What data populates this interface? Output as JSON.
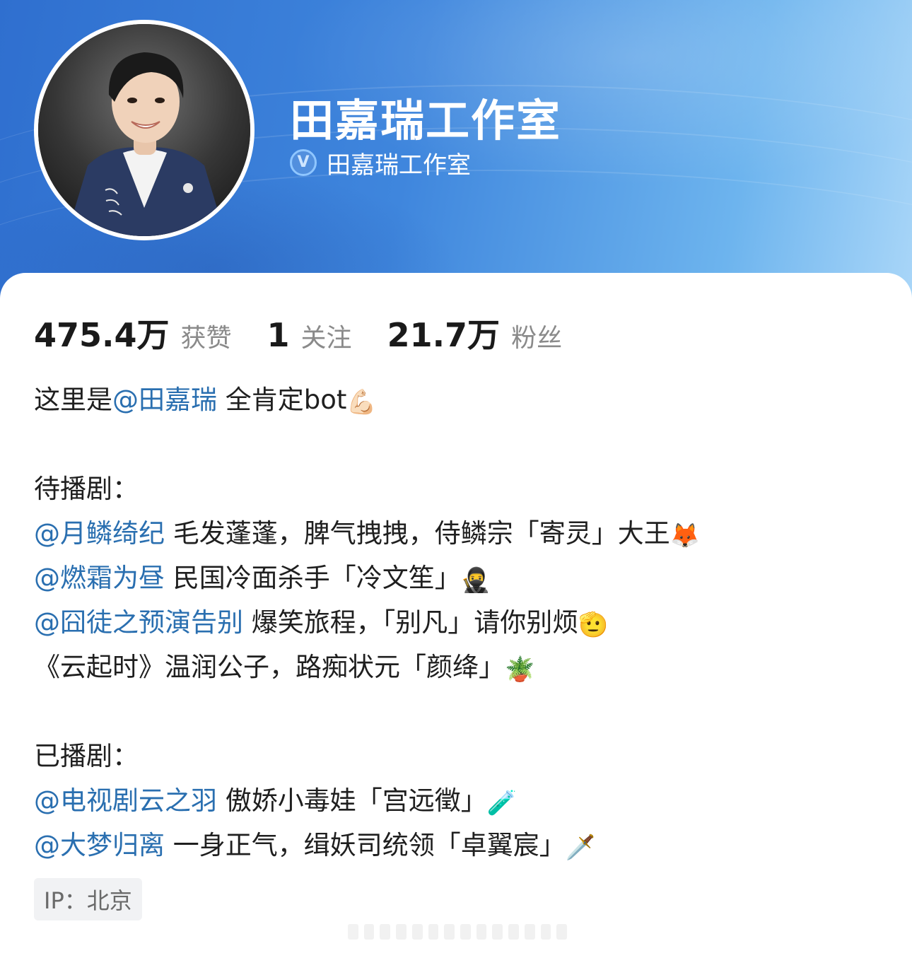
{
  "profile": {
    "name": "田嘉瑞工作室",
    "verified_label": "田嘉瑞工作室",
    "verified_icon": "verified-v-icon"
  },
  "stats": [
    {
      "value": "475.4万",
      "label": "获赞"
    },
    {
      "value": "1",
      "label": "关注"
    },
    {
      "value": "21.7万",
      "label": "粉丝"
    }
  ],
  "bio": {
    "intro": {
      "prefix": "这里是",
      "mention": "@田嘉瑞",
      "suffix": " 全肯定bot",
      "emoji": "💪🏻"
    },
    "upcoming_heading": "待播剧：",
    "upcoming": [
      {
        "mention": "@月鳞绮纪",
        "text": " 毛发蓬蓬，脾气拽拽，侍鳞宗「寄灵」大王",
        "emoji": "🦊"
      },
      {
        "mention": "@燃霜为昼",
        "text": " 民国冷面杀手「冷文笙」",
        "emoji": "🥷"
      },
      {
        "mention": "@囧徒之预演告别",
        "text": " 爆笑旅程，「别凡」请你别烦",
        "emoji": "🫡"
      },
      {
        "mention": "",
        "text": "《云起时》温润公子，路痴状元「颜绛」",
        "emoji": "🪴"
      }
    ],
    "aired_heading": "已播剧：",
    "aired": [
      {
        "mention": "@电视剧云之羽",
        "text": " 傲娇小毒娃「宫远徵」",
        "emoji": "🧪"
      },
      {
        "mention": "@大梦归离",
        "text": " 一身正气，缉妖司统领「卓翼宸」",
        "emoji": "🗡️"
      }
    ]
  },
  "ip_badge": "IP：北京",
  "colors": {
    "header_start": "#2f6fcf",
    "header_end": "#a9d6f8",
    "mention": "#2a6fb0",
    "label_gray": "#8a8a8a"
  }
}
